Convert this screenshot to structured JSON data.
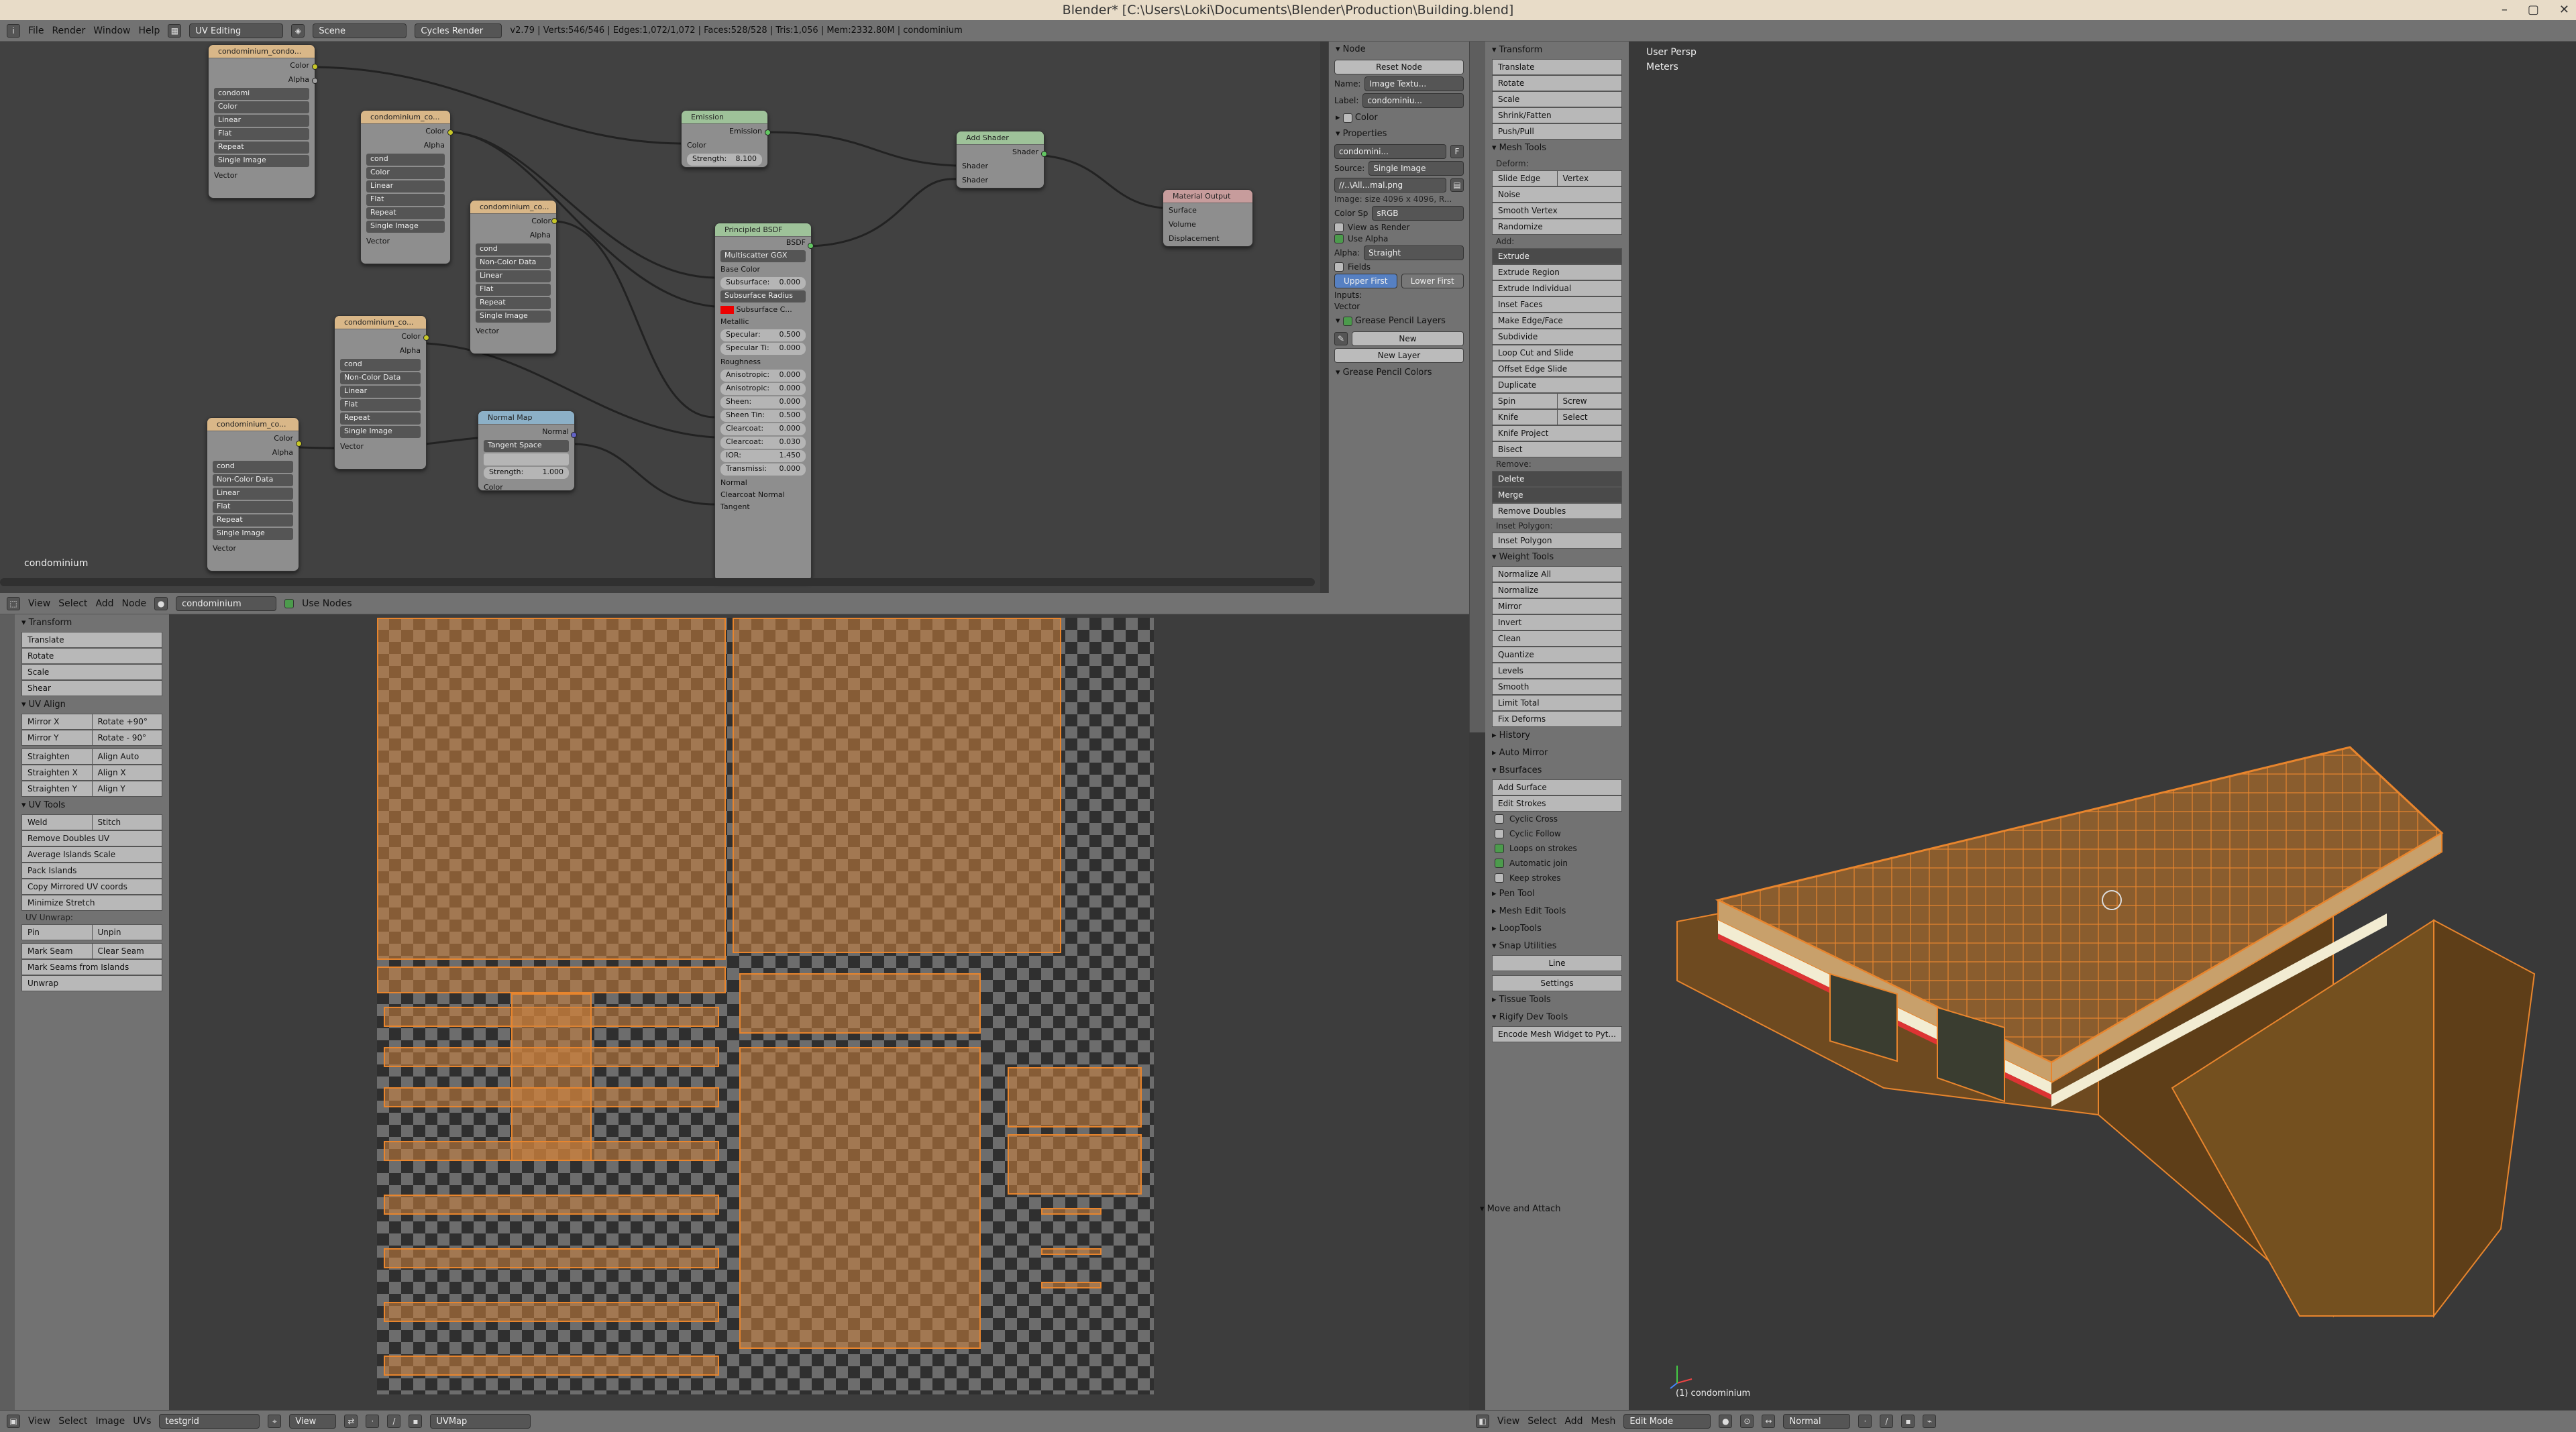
{
  "window": {
    "title": "Blender* [C:\\Users\\Loki\\Documents\\Blender\\Production\\Building.blend]"
  },
  "info": {
    "menus": [
      "File",
      "Render",
      "Window",
      "Help"
    ],
    "layout": "UV Editing",
    "scene": "Scene",
    "engine": "Cycles Render",
    "stats": "v2.79 | Verts:546/546 | Edges:1,072/1,072 | Faces:528/528 | Tris:1,056 | Mem:2332.80M | condominium"
  },
  "node_editor": {
    "menus": [
      "View",
      "Select",
      "Add",
      "Node"
    ],
    "material": "condominium",
    "use_nodes": "Use Nodes",
    "label": "condominium",
    "nodes": {
      "tex1": {
        "title": "condominium_condo...",
        "out1": "Color",
        "out2": "Alpha",
        "img": "condomi",
        "cs": "Color",
        "interp": "Linear",
        "proj": "Flat",
        "ext": "Repeat",
        "src": "Single Image",
        "vec": "Vector"
      },
      "tex2": {
        "title": "condominium_co...",
        "out1": "Color",
        "out2": "Alpha",
        "img": "cond",
        "cs": "Color",
        "interp": "Linear",
        "proj": "Flat",
        "ext": "Repeat",
        "src": "Single Image",
        "vec": "Vector"
      },
      "tex3": {
        "title": "condominium_co...",
        "out1": "Color",
        "out2": "Alpha",
        "img": "cond",
        "cs": "Non-Color Data",
        "interp": "Linear",
        "proj": "Flat",
        "ext": "Repeat",
        "src": "Single Image",
        "vec": "Vector"
      },
      "tex4": {
        "title": "condominium_co...",
        "out1": "Color",
        "out2": "Alpha",
        "img": "cond",
        "cs": "Non-Color Data",
        "interp": "Linear",
        "proj": "Flat",
        "ext": "Repeat",
        "src": "Single Image",
        "vec": "Vector"
      },
      "tex5": {
        "title": "condominium_co...",
        "out1": "Color",
        "out2": "Alpha",
        "img": "cond",
        "cs": "Non-Color Data",
        "interp": "Linear",
        "proj": "Flat",
        "ext": "Repeat",
        "src": "Single Image",
        "vec": "Vector"
      },
      "emission": {
        "title": "Emission",
        "out": "Emission",
        "color": "Color",
        "strength": "Strength:",
        "strength_val": "8.100"
      },
      "addshader": {
        "title": "Add Shader",
        "out": "Shader",
        "in1": "Shader",
        "in2": "Shader"
      },
      "output": {
        "title": "Material Output",
        "in1": "Surface",
        "in2": "Volume",
        "in3": "Displacement"
      },
      "normalmap": {
        "title": "Normal Map",
        "out": "Normal",
        "space": "Tangent Space",
        "strength": "Strength:",
        "strength_val": "1.000",
        "color": "Color"
      },
      "bsdf": {
        "title": "Principled BSDF",
        "out": "BSDF",
        "dist": "Multiscatter GGX",
        "base": "Base Color",
        "ss": "Subsurface:",
        "ss_v": "0.000",
        "ssr": "Subsurface Radius",
        "ssc": "Subsurface C...",
        "metal": "Metallic",
        "spec": "Specular:",
        "spec_v": "0.500",
        "spect": "Specular Ti:",
        "spect_v": "0.000",
        "rough": "Roughness",
        "aniso": "Anisotropic:",
        "aniso_v": "0.000",
        "anisor": "Anisotropic:",
        "anisor_v": "0.000",
        "sheen": "Sheen:",
        "sheen_v": "0.000",
        "sheent": "Sheen Tin:",
        "sheent_v": "0.500",
        "cc": "Clearcoat:",
        "cc_v": "0.000",
        "ccr": "Clearcoat:",
        "ccr_v": "0.030",
        "ior": "IOR:",
        "ior_v": "1.450",
        "trans": "Transmissi:",
        "trans_v": "0.000",
        "normal": "Normal",
        "ccn": "Clearcoat Normal",
        "tangent": "Tangent"
      }
    }
  },
  "node_panel": {
    "node": "Node",
    "reset": "Reset Node",
    "name_l": "Name:",
    "name_v": "Image Textu...",
    "label_l": "Label:",
    "label_v": "condominiu...",
    "color": "Color",
    "properties": "Properties",
    "img": "condomini...",
    "img_f": "F",
    "source_l": "Source:",
    "source_v": "Single Image",
    "path": "//..\\All...mal.png",
    "size": "Image: size 4096 x 4096, R...",
    "colorsp_l": "Color Sp",
    "colorsp_v": "sRGB",
    "view_render": "View as Render",
    "use_alpha": "Use Alpha",
    "alpha_l": "Alpha:",
    "alpha_v": "Straight",
    "fields": "Fields",
    "upper": "Upper First",
    "lower": "Lower First",
    "inputs": "Inputs:",
    "vector": "Vector",
    "gp_layers": "Grease Pencil Layers",
    "new": "New",
    "new_layer": "New Layer",
    "gp_colors": "Grease Pencil Colors"
  },
  "shelf": {
    "transform": "Transform",
    "translate": "Translate",
    "rotate": "Rotate",
    "scale": "Scale",
    "shrink": "Shrink/Fatten",
    "push": "Push/Pull",
    "mesh_tools": "Mesh Tools",
    "deform": "Deform:",
    "slide_edge": "Slide Edge",
    "vertex": "Vertex",
    "noise": "Noise",
    "smooth_vertex": "Smooth Vertex",
    "randomize": "Randomize",
    "add": "Add:",
    "extrude": "Extrude",
    "extrude_region": "Extrude Region",
    "extrude_ind": "Extrude Individual",
    "inset": "Inset Faces",
    "make_edge": "Make Edge/Face",
    "subdivide": "Subdivide",
    "loop_cut": "Loop Cut and Slide",
    "offset_edge": "Offset Edge Slide",
    "duplicate": "Duplicate",
    "spin": "Spin",
    "screw": "Screw",
    "knife": "Knife",
    "select": "Select",
    "knife_project": "Knife Project",
    "bisect": "Bisect",
    "remove": "Remove:",
    "delete": "Delete",
    "merge": "Merge",
    "remove_doubles": "Remove Doubles",
    "inset_poly_l": "Inset Polygon:",
    "inset_poly": "Inset Polygon",
    "weight_tools": "Weight Tools",
    "normalize_all": "Normalize All",
    "normalize": "Normalize",
    "mirror": "Mirror",
    "invert": "Invert",
    "clean": "Clean",
    "quantize": "Quantize",
    "levels": "Levels",
    "smooth": "Smooth",
    "limit_total": "Limit Total",
    "fix_deforms": "Fix Deforms",
    "history": "History",
    "auto_mirror": "Auto Mirror",
    "bsurfaces": "Bsurfaces",
    "add_surface": "Add Surface",
    "edit_strokes": "Edit Strokes",
    "cyclic_cross": "Cyclic Cross",
    "cyclic_follow": "Cyclic Follow",
    "loops_strokes": "Loops on strokes",
    "automatic_join": "Automatic join",
    "keep_strokes": "Keep strokes",
    "pen_tool": "Pen Tool",
    "mesh_edit": "Mesh Edit Tools",
    "looptools": "LoopTools",
    "snap_util": "Snap Utilities",
    "line": "Line",
    "settings": "Settings",
    "tissue": "Tissue Tools",
    "rigify": "Rigify Dev Tools",
    "encode": "Encode Mesh Widget to Pyt...",
    "move_attach": "Move and Attach"
  },
  "uv_shelf": {
    "transform": "Transform",
    "translate": "Translate",
    "rotate": "Rotate",
    "scale": "Scale",
    "shear": "Shear",
    "uv_align": "UV Align",
    "mirror_x": "Mirror X",
    "rot90": "Rotate +90°",
    "mirror_y": "Mirror Y",
    "rotm90": "Rotate - 90°",
    "straighten": "Straighten",
    "align_auto": "Align Auto",
    "straighten_x": "Straighten X",
    "align_x": "Align X",
    "straighten_y": "Straighten Y",
    "align_y": "Align Y",
    "uv_tools": "UV Tools",
    "weld": "Weld",
    "stitch": "Stitch",
    "remove_doubles": "Remove Doubles UV",
    "avg_islands": "Average Islands Scale",
    "pack": "Pack Islands",
    "copy_mirrored": "Copy Mirrored UV coords",
    "minimize": "Minimize Stretch",
    "uv_unwrap": "UV Unwrap:",
    "pin": "Pin",
    "unpin": "Unpin",
    "mark_seam": "Mark Seam",
    "clear_seam": "Clear Seam",
    "mark_seams_islands": "Mark Seams from Islands",
    "unwrap": "Unwrap"
  },
  "view3d": {
    "persp": "User Persp",
    "units": "Meters",
    "object": "(1) condominium"
  },
  "uv_footer": {
    "menus": [
      "View",
      "Select",
      "Image",
      "UVs"
    ],
    "image": "testgrid",
    "uvmap": "UVMap",
    "view": "View"
  },
  "v3d_footer": {
    "menus": [
      "View",
      "Select",
      "Add",
      "Mesh"
    ],
    "mode": "Edit Mode",
    "pivot": "Normal"
  },
  "colors": {
    "accent": "#e8852d",
    "selected": "#ffaa40",
    "panel": "#727272",
    "node_bg": "#414141"
  }
}
